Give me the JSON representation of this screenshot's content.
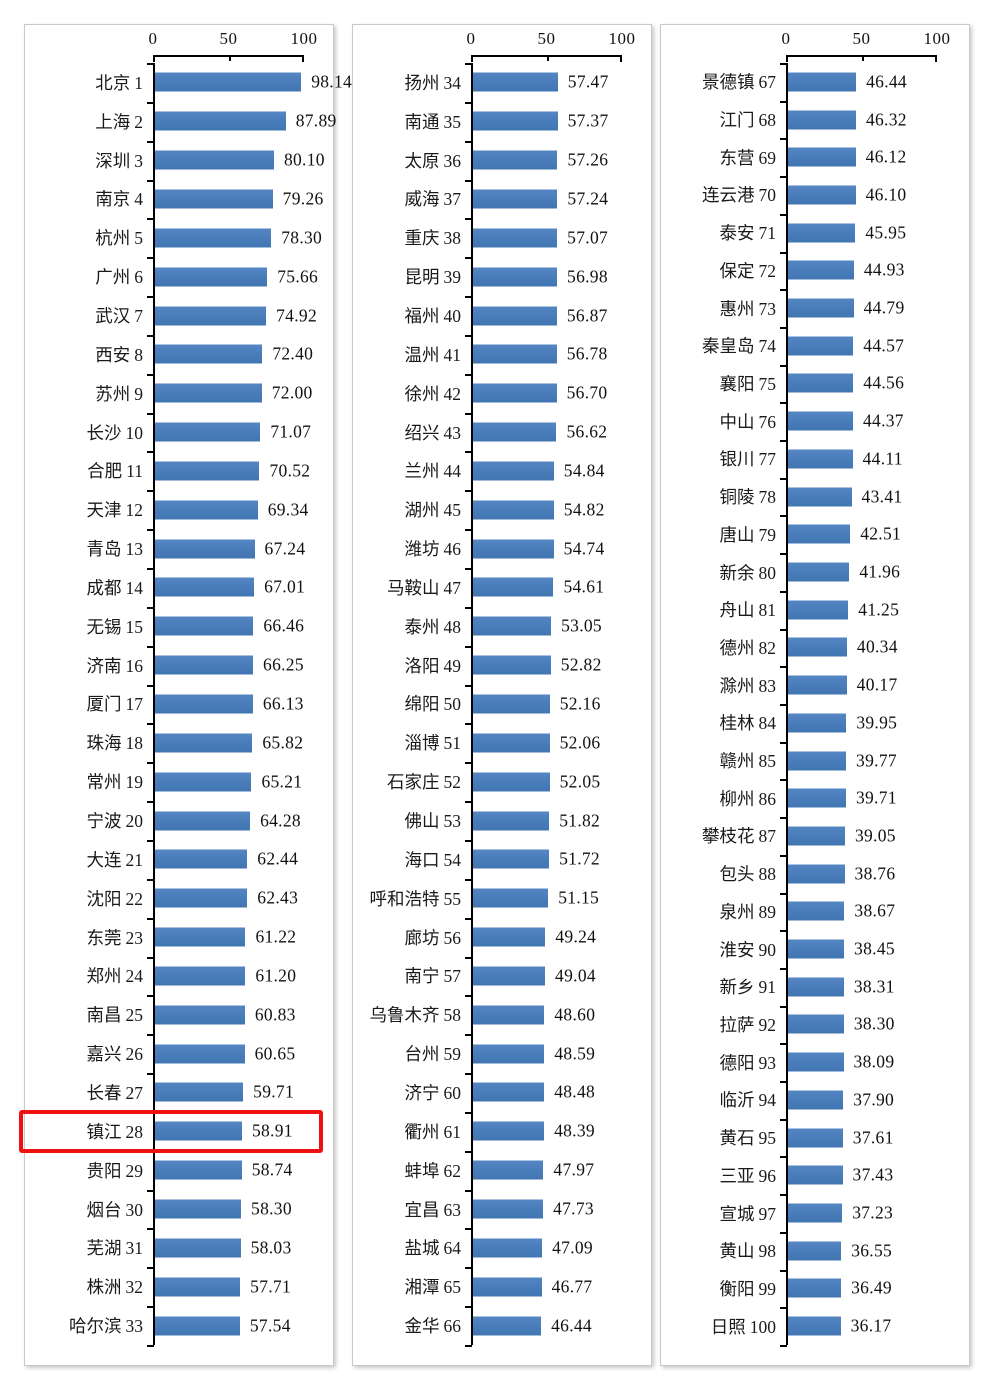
{
  "chart_data": {
    "type": "bar",
    "orientation": "horizontal",
    "title": "",
    "xlabel": "",
    "ylabel": "",
    "xlim": [
      0,
      100
    ],
    "xticks": [
      0,
      50,
      100
    ],
    "xtick_labels": [
      "0",
      "50",
      "100"
    ],
    "grid": false,
    "legend": "none",
    "bar_color": "#4a7ebb",
    "highlight_color": "#ee1111",
    "highlighted_rank": 28,
    "panels": [
      {
        "panel_id": "panel-1",
        "categories": [
          "北京",
          "上海",
          "深圳",
          "南京",
          "杭州",
          "广州",
          "武汉",
          "西安",
          "苏州",
          "长沙",
          "合肥",
          "天津",
          "青岛",
          "成都",
          "无锡",
          "济南",
          "厦门",
          "珠海",
          "常州",
          "宁波",
          "大连",
          "沈阳",
          "东莞",
          "郑州",
          "南昌",
          "嘉兴",
          "长春",
          "镇江",
          "贵阳",
          "烟台",
          "芜湖",
          "株洲",
          "哈尔滨"
        ],
        "ranks": [
          1,
          2,
          3,
          4,
          5,
          6,
          7,
          8,
          9,
          10,
          11,
          12,
          13,
          14,
          15,
          16,
          17,
          18,
          19,
          20,
          21,
          22,
          23,
          24,
          25,
          26,
          27,
          28,
          29,
          30,
          31,
          32,
          33
        ],
        "values": [
          98.14,
          87.89,
          80.1,
          79.26,
          78.3,
          75.66,
          74.92,
          72.4,
          72.0,
          71.07,
          70.52,
          69.34,
          67.24,
          67.01,
          66.46,
          66.25,
          66.13,
          65.82,
          65.21,
          64.28,
          62.44,
          62.43,
          61.22,
          61.2,
          60.83,
          60.65,
          59.71,
          58.91,
          58.74,
          58.3,
          58.03,
          57.71,
          57.54
        ],
        "value_labels": [
          "98.14",
          "87.89",
          "80.10",
          "79.26",
          "78.30",
          "75.66",
          "74.92",
          "72.40",
          "72.00",
          "71.07",
          "70.52",
          "69.34",
          "67.24",
          "67.01",
          "66.46",
          "66.25",
          "66.13",
          "65.82",
          "65.21",
          "64.28",
          "62.44",
          "62.43",
          "61.22",
          "61.20",
          "60.83",
          "60.65",
          "59.71",
          "58.91",
          "58.74",
          "58.30",
          "58.03",
          "57.71",
          "57.54"
        ]
      },
      {
        "panel_id": "panel-2",
        "categories": [
          "扬州",
          "南通",
          "太原",
          "威海",
          "重庆",
          "昆明",
          "福州",
          "温州",
          "徐州",
          "绍兴",
          "兰州",
          "湖州",
          "潍坊",
          "马鞍山",
          "泰州",
          "洛阳",
          "绵阳",
          "淄博",
          "石家庄",
          "佛山",
          "海口",
          "呼和浩特",
          "廊坊",
          "南宁",
          "乌鲁木齐",
          "台州",
          "济宁",
          "衢州",
          "蚌埠",
          "宜昌",
          "盐城",
          "湘潭",
          "金华"
        ],
        "ranks": [
          34,
          35,
          36,
          37,
          38,
          39,
          40,
          41,
          42,
          43,
          44,
          45,
          46,
          47,
          48,
          49,
          50,
          51,
          52,
          53,
          54,
          55,
          56,
          57,
          58,
          59,
          60,
          61,
          62,
          63,
          64,
          65,
          66
        ],
        "values": [
          57.47,
          57.37,
          57.26,
          57.24,
          57.07,
          56.98,
          56.87,
          56.78,
          56.7,
          56.62,
          54.84,
          54.82,
          54.74,
          54.61,
          53.05,
          52.82,
          52.16,
          52.06,
          52.05,
          51.82,
          51.72,
          51.15,
          49.24,
          49.04,
          48.6,
          48.59,
          48.48,
          48.39,
          47.97,
          47.73,
          47.09,
          46.77,
          46.44
        ],
        "value_labels": [
          "57.47",
          "57.37",
          "57.26",
          "57.24",
          "57.07",
          "56.98",
          "56.87",
          "56.78",
          "56.70",
          "56.62",
          "54.84",
          "54.82",
          "54.74",
          "54.61",
          "53.05",
          "52.82",
          "52.16",
          "52.06",
          "52.05",
          "51.82",
          "51.72",
          "51.15",
          "49.24",
          "49.04",
          "48.60",
          "48.59",
          "48.48",
          "48.39",
          "47.97",
          "47.73",
          "47.09",
          "46.77",
          "46.44"
        ]
      },
      {
        "panel_id": "panel-3",
        "categories": [
          "景德镇",
          "江门",
          "东营",
          "连云港",
          "泰安",
          "保定",
          "惠州",
          "秦皇岛",
          "襄阳",
          "中山",
          "银川",
          "铜陵",
          "唐山",
          "新余",
          "舟山",
          "德州",
          "滁州",
          "桂林",
          "赣州",
          "柳州",
          "攀枝花",
          "包头",
          "泉州",
          "淮安",
          "新乡",
          "拉萨",
          "德阳",
          "临沂",
          "黄石",
          "三亚",
          "宣城",
          "黄山",
          "衡阳",
          "日照"
        ],
        "ranks": [
          67,
          68,
          69,
          70,
          71,
          72,
          73,
          74,
          75,
          76,
          77,
          78,
          79,
          80,
          81,
          82,
          83,
          84,
          85,
          86,
          87,
          88,
          89,
          90,
          91,
          92,
          93,
          94,
          95,
          96,
          97,
          98,
          99,
          100
        ],
        "values": [
          46.44,
          46.32,
          46.12,
          46.1,
          45.95,
          44.93,
          44.79,
          44.57,
          44.56,
          44.37,
          44.11,
          43.41,
          42.51,
          41.96,
          41.25,
          40.34,
          40.17,
          39.95,
          39.77,
          39.71,
          39.05,
          38.76,
          38.67,
          38.45,
          38.31,
          38.3,
          38.09,
          37.9,
          37.61,
          37.43,
          37.23,
          36.55,
          36.49,
          36.17
        ],
        "value_labels": [
          "46.44",
          "46.32",
          "46.12",
          "46.10",
          "45.95",
          "44.93",
          "44.79",
          "44.57",
          "44.56",
          "44.37",
          "44.11",
          "43.41",
          "42.51",
          "41.96",
          "41.25",
          "40.34",
          "40.17",
          "39.95",
          "39.77",
          "39.71",
          "39.05",
          "38.76",
          "38.67",
          "38.45",
          "38.31",
          "38.30",
          "38.09",
          "37.90",
          "37.61",
          "37.43",
          "37.23",
          "36.55",
          "36.49",
          "36.17"
        ]
      }
    ]
  }
}
